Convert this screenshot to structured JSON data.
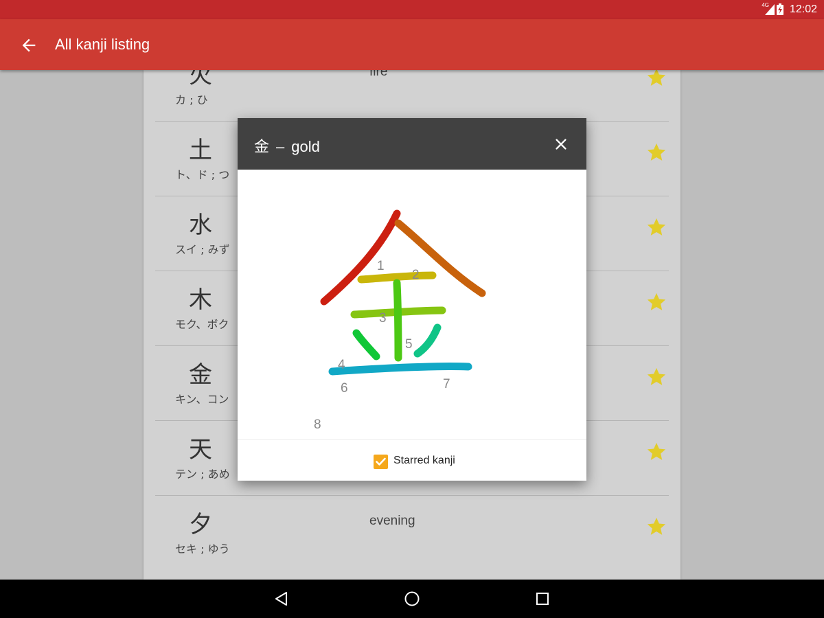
{
  "status_bar": {
    "network": "4G",
    "time": "12:02"
  },
  "app_bar": {
    "title": "All kanji listing",
    "back_icon": "arrow-back-icon"
  },
  "list": [
    {
      "kanji": "火",
      "reading": "カ ; ひ",
      "meaning": "fire",
      "starred": true
    },
    {
      "kanji": "土",
      "reading": "ト、ド ; つ",
      "meaning": "",
      "starred": true
    },
    {
      "kanji": "水",
      "reading": "スイ ; みず",
      "meaning": "",
      "starred": true
    },
    {
      "kanji": "木",
      "reading": "モク、ボク",
      "meaning": "",
      "starred": true
    },
    {
      "kanji": "金",
      "reading": "キン、コン",
      "meaning": "",
      "starred": true
    },
    {
      "kanji": "天",
      "reading": "テン ; あめ",
      "meaning": "",
      "starred": true
    },
    {
      "kanji": "夕",
      "reading": "セキ ; ゆう",
      "meaning": "evening",
      "starred": true
    }
  ],
  "dialog": {
    "kanji": "金",
    "separator": "–",
    "meaning": "gold",
    "close_icon": "close-icon",
    "stroke_numbers": [
      "1",
      "2",
      "3",
      "4",
      "5",
      "6",
      "7",
      "8"
    ],
    "stroke_colors": [
      "#cc1f10",
      "#c8620c",
      "#c9b60a",
      "#86c512",
      "#4cc814",
      "#11c737",
      "#10c487",
      "#11a8c6"
    ],
    "starred_label": "Starred kanji",
    "starred_checked": true
  },
  "colors": {
    "status_bar": "#c1292b",
    "app_bar": "#cd3b32",
    "dialog_header": "#414141",
    "star": "#e2cc2a",
    "checkbox": "#f5a81c"
  },
  "nav_bar": {
    "back": "nav-back-icon",
    "home": "nav-home-icon",
    "recents": "nav-recents-icon"
  }
}
